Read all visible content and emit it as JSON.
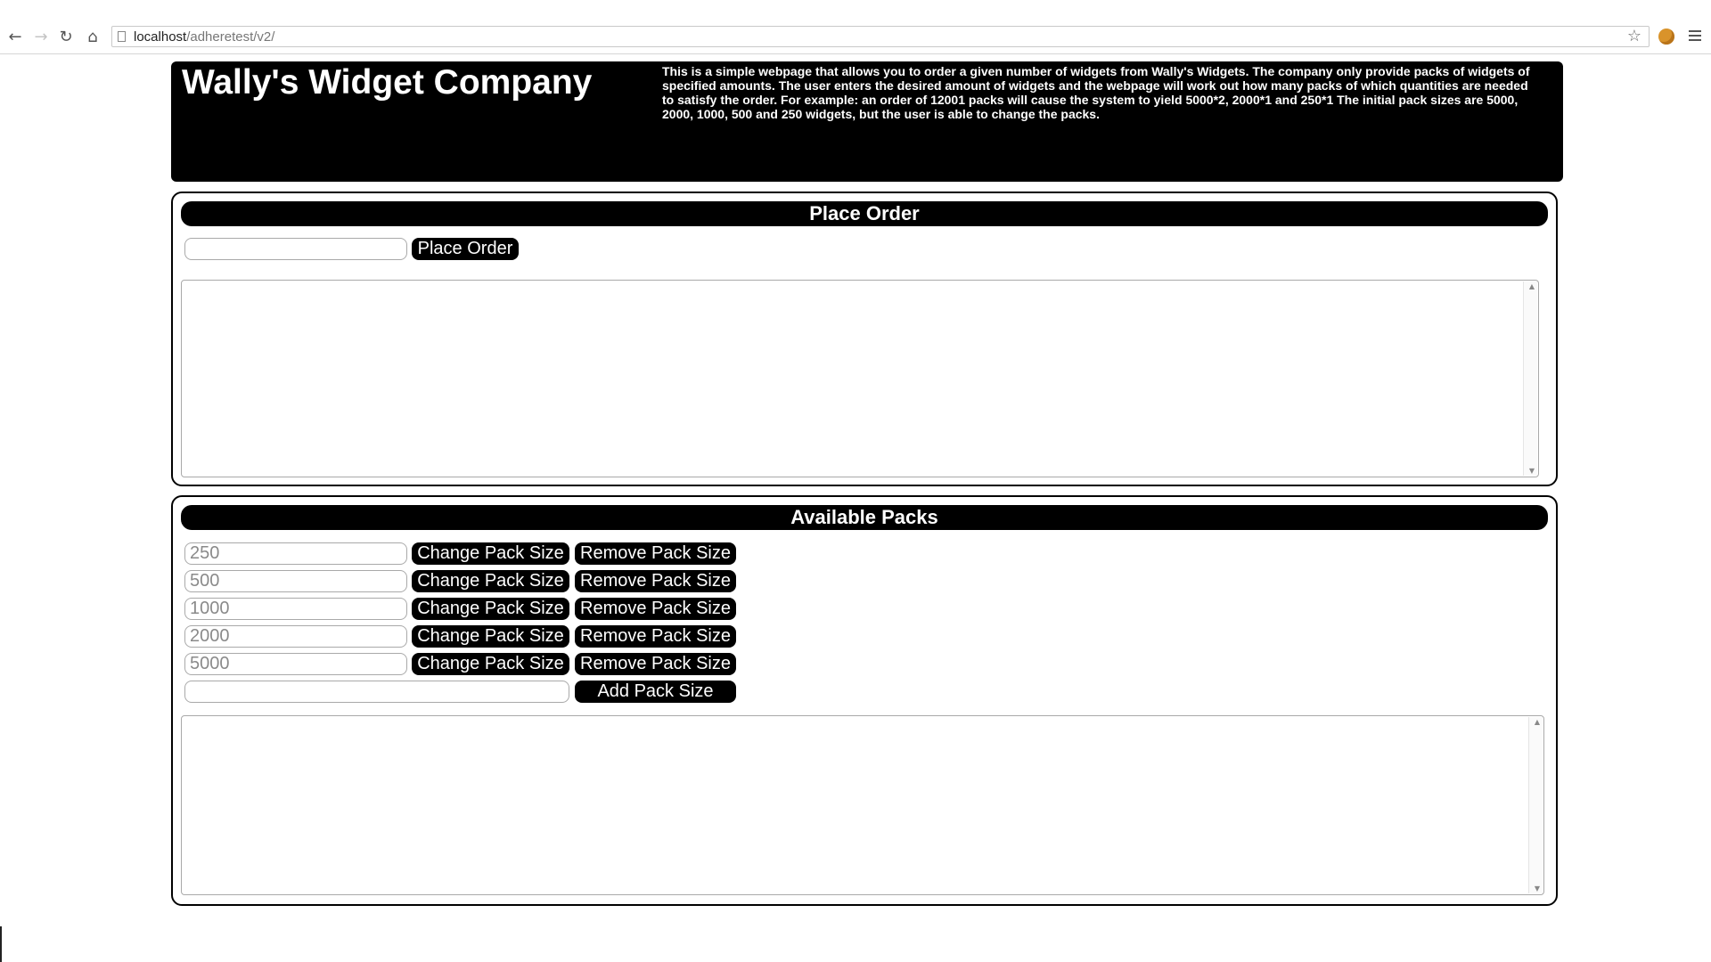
{
  "browser": {
    "url_host": "localhost",
    "url_path": "/adheretest/v2/"
  },
  "header": {
    "title": "Wally's Widget Company",
    "description": "This is a simple webpage that allows you to order a given number of widgets from Wally's Widgets. The company only provide packs of widgets of specified amounts. The user enters the desired amount of widgets and the webpage will work out how many packs of which quantities are needed to satisfy the order. For example: an order of 12001 packs will cause the system to yield 5000*2, 2000*1 and 250*1 The initial pack sizes are 5000, 2000, 1000, 500 and 250 widgets, but the user is able to change the packs."
  },
  "order": {
    "title": "Place Order",
    "input_value": "",
    "button_label": "Place Order",
    "output_text": ""
  },
  "packs": {
    "title": "Available Packs",
    "change_label": "Change Pack Size",
    "remove_label": "Remove Pack Size",
    "add_label": "Add Pack Size",
    "new_pack_value": "",
    "items": [
      {
        "placeholder": "250"
      },
      {
        "placeholder": "500"
      },
      {
        "placeholder": "1000"
      },
      {
        "placeholder": "2000"
      },
      {
        "placeholder": "5000"
      }
    ],
    "output_text": ""
  }
}
